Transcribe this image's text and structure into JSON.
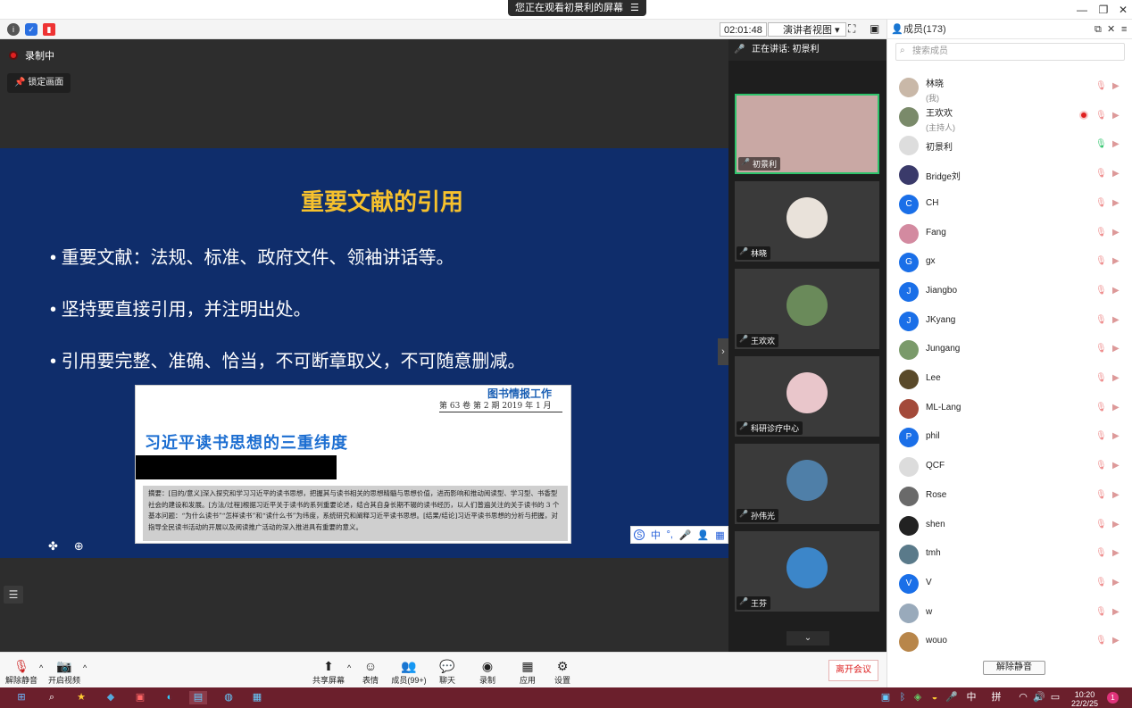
{
  "window": {
    "viewing_banner": "您正在观看初景利的屏幕",
    "banner_menu_icon": "menu-icon"
  },
  "infobar": {
    "timer": "02:01:48",
    "view_mode": "演讲者视图"
  },
  "stage": {
    "recording_label": "录制中",
    "lock_screen_label": "锁定画面"
  },
  "slide": {
    "title": "重要文献的引用",
    "bullets": [
      "重要文献：法规、标准、政府文件、领袖讲话等。",
      "坚持要直接引用，并注明出处。",
      "引用要完整、准确、恰当，不可断章取义，不可随意删减。"
    ],
    "doc": {
      "journal": "图书情报工作",
      "issue": "第 63 卷 第 2 期   2019 年 1 月",
      "title": "习近平读书思想的三重纬度",
      "abstract": "摘要：[目的/意义]深入探究和学习习近平的读书思想，把握其与读书相关的思想精髓与思想价值，进而影响和推动阅读型、学习型、书香型社会的建设和发展。[方法/过程]根据习近平关于读书的系列重要论述，结合其自身长期不辍的读书经历，以人们普遍关注的关于读书的 3 个基本问题：“为什么读书”“怎样读书”和“读什么书”为纬度，系统研究和阐释习近平读书思想。[结果/结论]习近平读书思想的分析与把握，对指导全民读书活动的开展以及阅读推广活动的深入推进具有重要的意义。"
    },
    "ime_toolbar": [
      "中",
      "°,",
      "🎤",
      "👤",
      "▦"
    ]
  },
  "video": {
    "speaking_label": "正在讲话: 初景利",
    "tiles": [
      {
        "name": "初景利",
        "color": "#c9a8a4"
      },
      {
        "name": "林晓",
        "color": "#e9e2da"
      },
      {
        "name": "王欢欢",
        "color": "#6a8a5a"
      },
      {
        "name": "科研诊疗中心",
        "color": "#e9c6cb"
      },
      {
        "name": "孙伟光",
        "color": "#4f7fa8"
      },
      {
        "name": "王芬",
        "color": "#3c86c9"
      }
    ]
  },
  "members": {
    "header": "成员(173)",
    "search_placeholder": "搜索成员",
    "list": [
      {
        "name": "林晓",
        "sub": "(我)",
        "avatar": "",
        "color": "#c9b8a8"
      },
      {
        "name": "王欢欢",
        "sub": "(主持人)",
        "avatar": "",
        "color": "#7a8a6a",
        "recording": true
      },
      {
        "name": "初景利",
        "sub": "",
        "avatar": "",
        "color": "#ddd"
      },
      {
        "name": "Bridge刘",
        "sub": "",
        "avatar": "",
        "color": "#3a3a6a"
      },
      {
        "name": "CH",
        "sub": "",
        "avatar": "C",
        "color": "#1a6fe8"
      },
      {
        "name": "Fang",
        "sub": "",
        "avatar": "",
        "color": "#d38aa0"
      },
      {
        "name": "gx",
        "sub": "",
        "avatar": "G",
        "color": "#1a6fe8"
      },
      {
        "name": "Jiangbo",
        "sub": "",
        "avatar": "J",
        "color": "#1a6fe8"
      },
      {
        "name": "JKyang",
        "sub": "",
        "avatar": "J",
        "color": "#1a6fe8"
      },
      {
        "name": "Jungang",
        "sub": "",
        "avatar": "",
        "color": "#7a9a6a"
      },
      {
        "name": "Lee",
        "sub": "",
        "avatar": "",
        "color": "#5a4a2a"
      },
      {
        "name": "ML-Lang",
        "sub": "",
        "avatar": "",
        "color": "#a34a3a"
      },
      {
        "name": "phil",
        "sub": "",
        "avatar": "P",
        "color": "#1a6fe8"
      },
      {
        "name": "QCF",
        "sub": "",
        "avatar": "",
        "color": "#dcdcdc"
      },
      {
        "name": "Rose",
        "sub": "",
        "avatar": "",
        "color": "#6a6a6a"
      },
      {
        "name": "shen",
        "sub": "",
        "avatar": "",
        "color": "#222"
      },
      {
        "name": "tmh",
        "sub": "",
        "avatar": "",
        "color": "#5a7a8a"
      },
      {
        "name": "V",
        "sub": "",
        "avatar": "V",
        "color": "#1a6fe8"
      },
      {
        "name": "w",
        "sub": "",
        "avatar": "",
        "color": "#9ab"
      },
      {
        "name": "wouo",
        "sub": "",
        "avatar": "",
        "color": "#b8864a"
      }
    ],
    "unmute_all": "解除静音"
  },
  "toolbar": {
    "mute": "解除静音",
    "video": "开启视频",
    "share": "共享屏幕",
    "react": "表情",
    "members": "成员(99+)",
    "chat": "聊天",
    "record": "录制",
    "apps": "应用",
    "settings": "设置",
    "leave": "离开会议"
  },
  "taskbar": {
    "ime_lang": "中",
    "ime_mode": "拼",
    "time": "10:20",
    "date": "22/2/25"
  }
}
